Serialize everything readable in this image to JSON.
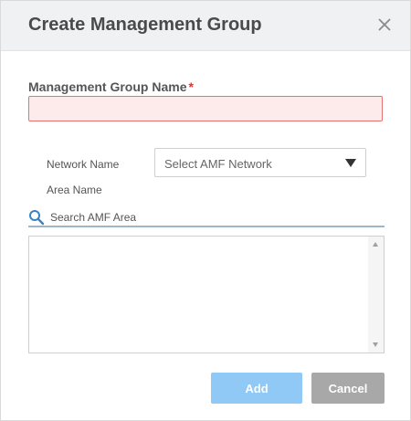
{
  "dialog": {
    "title": "Create Management Group",
    "close_icon": "close-icon"
  },
  "form": {
    "mg_name_label": "Management Group Name",
    "required_mark": "*",
    "mg_name_value": "",
    "network_label": "Network Name",
    "network_select_value": "Select AMF Network",
    "area_label": "Area Name",
    "search_placeholder": "Search AMF Area",
    "search_icon": "search-icon",
    "area_items": []
  },
  "buttons": {
    "add_label": "Add",
    "cancel_label": "Cancel"
  },
  "colors": {
    "header_bg": "#f0f1f3",
    "required": "#d93636",
    "error_border": "#e57373",
    "error_bg": "#fdeaea",
    "add_button": "#90c8f6",
    "cancel_button": "#a8a8a8",
    "search_underline": "#9bb7c9",
    "search_icon": "#3a82c4"
  }
}
